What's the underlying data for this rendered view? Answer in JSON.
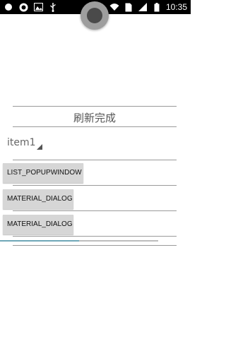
{
  "status_bar": {
    "time": "10:35",
    "left_icons": [
      "notification-dot-icon",
      "app-icon",
      "image-icon",
      "usb-icon"
    ],
    "right_icons": [
      "alarm-icon",
      "wifi-icon",
      "sim-icon",
      "signal-icon",
      "battery-icon"
    ]
  },
  "refresh": {
    "status_text": "刷新完成"
  },
  "spinner": {
    "selected": "item1"
  },
  "buttons": {
    "list_popupwindow": "LIST_POPUPWINDOW",
    "material_dialog_1": "MATERIAL_DIALOG",
    "material_dialog_2": "MATERIAL_DIALOG"
  },
  "progress": {
    "value": 0.5
  },
  "colors": {
    "status_bar": "#000000",
    "progress_fill": "#6fa7b7",
    "button_bg": "#d6d6d6"
  }
}
